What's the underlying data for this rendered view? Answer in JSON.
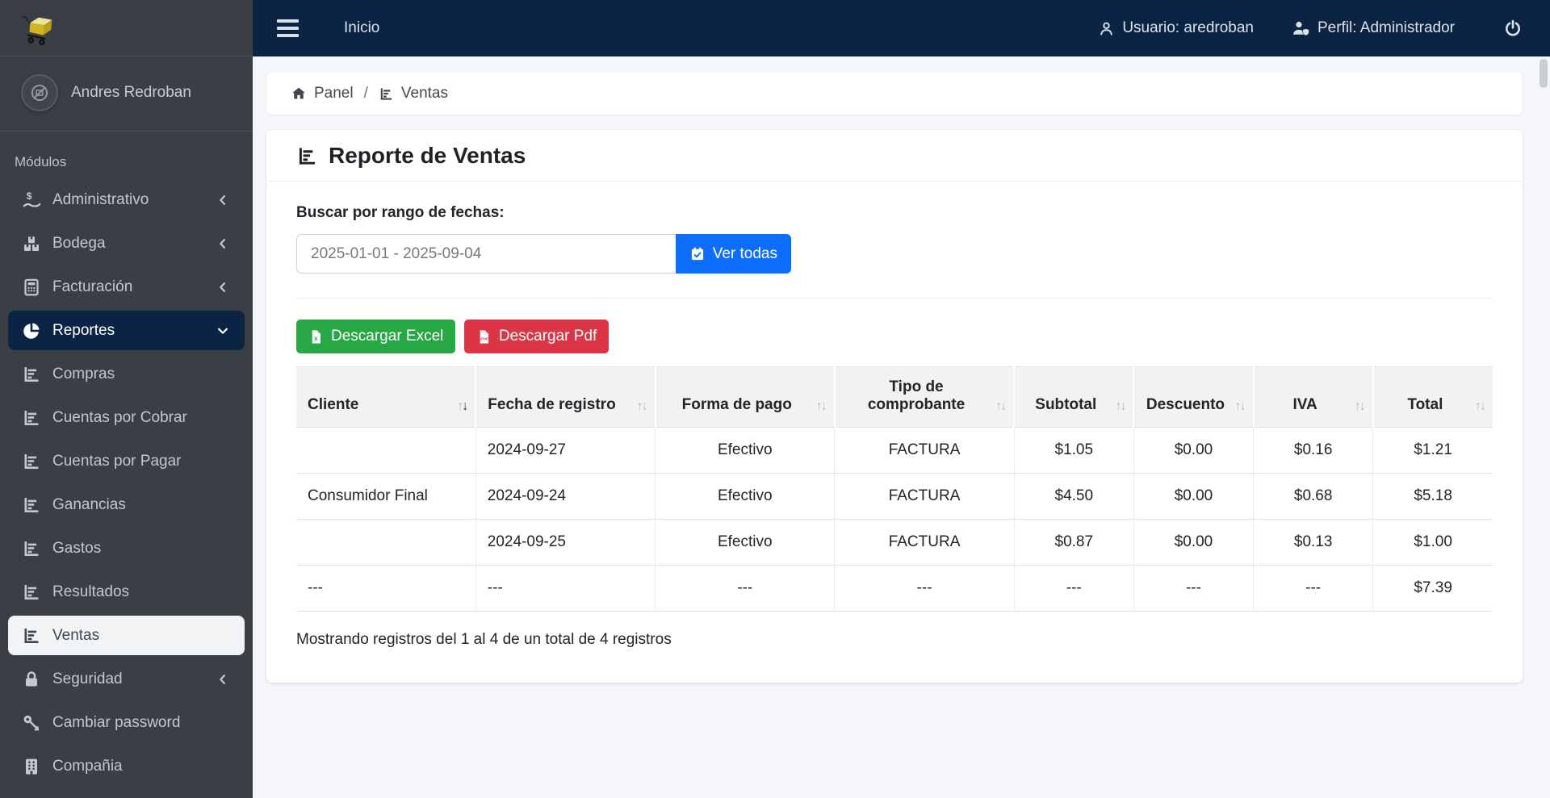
{
  "colors": {
    "navbar_navy": "#0c2444",
    "sidebar_dark": "#3a3f45",
    "primary_blue": "#0d6efd",
    "success_green": "#28a745",
    "danger_red": "#dc3545",
    "page_background": "#f4f6f9"
  },
  "navbar": {
    "menu_link": "Inicio",
    "user_label": "Usuario: aredroban",
    "profile_label": "Perfil: Administrador"
  },
  "sidebar": {
    "user_name": "Andres Redroban",
    "section_label": "Módulos",
    "items": [
      {
        "label": "Administrativo",
        "icon": "hand-holding-dollar-icon"
      },
      {
        "label": "Bodega",
        "icon": "boxes-icon"
      },
      {
        "label": "Facturación",
        "icon": "calculator-icon"
      },
      {
        "label": "Reportes",
        "icon": "chart-pie-icon"
      },
      {
        "label": "Compras",
        "icon": "chart-bar-icon"
      },
      {
        "label": "Cuentas por Cobrar",
        "icon": "chart-bar-icon"
      },
      {
        "label": "Cuentas por Pagar",
        "icon": "chart-bar-icon"
      },
      {
        "label": "Ganancias",
        "icon": "chart-bar-icon"
      },
      {
        "label": "Gastos",
        "icon": "chart-bar-icon"
      },
      {
        "label": "Resultados",
        "icon": "chart-bar-icon"
      },
      {
        "label": "Ventas",
        "icon": "chart-bar-icon"
      },
      {
        "label": "Seguridad",
        "icon": "lock-icon"
      },
      {
        "label": "Cambiar password",
        "icon": "key-icon"
      },
      {
        "label": "Compañia",
        "icon": "building-icon"
      }
    ]
  },
  "breadcrumb": {
    "home_label": "Panel",
    "separator": "/",
    "current_label": "Ventas"
  },
  "report": {
    "title": "Reporte de Ventas",
    "search_label": "Buscar por rango de fechas:",
    "date_range_value": "2025-01-01 - 2025-09-04",
    "view_all_button": "Ver todas",
    "excel_button": "Descargar Excel",
    "pdf_button": "Descargar Pdf",
    "footer_info": "Mostrando registros del 1 al 4 de un total de 4 registros"
  },
  "table": {
    "sort_up": "↑",
    "sort_down": "↓",
    "headers": [
      "Cliente",
      "Fecha de registro",
      "Forma de pago",
      "Tipo de comprobante",
      "Subtotal",
      "Descuento",
      "IVA",
      "Total"
    ],
    "rows": [
      [
        "",
        "2024-09-27",
        "Efectivo",
        "FACTURA",
        "$1.05",
        "$0.00",
        "$0.16",
        "$1.21"
      ],
      [
        "Consumidor Final",
        "2024-09-24",
        "Efectivo",
        "FACTURA",
        "$4.50",
        "$0.00",
        "$0.68",
        "$5.18"
      ],
      [
        "",
        "2024-09-25",
        "Efectivo",
        "FACTURA",
        "$0.87",
        "$0.00",
        "$0.13",
        "$1.00"
      ],
      [
        "---",
        "---",
        "---",
        "---",
        "---",
        "---",
        "---",
        "$7.39"
      ]
    ]
  }
}
